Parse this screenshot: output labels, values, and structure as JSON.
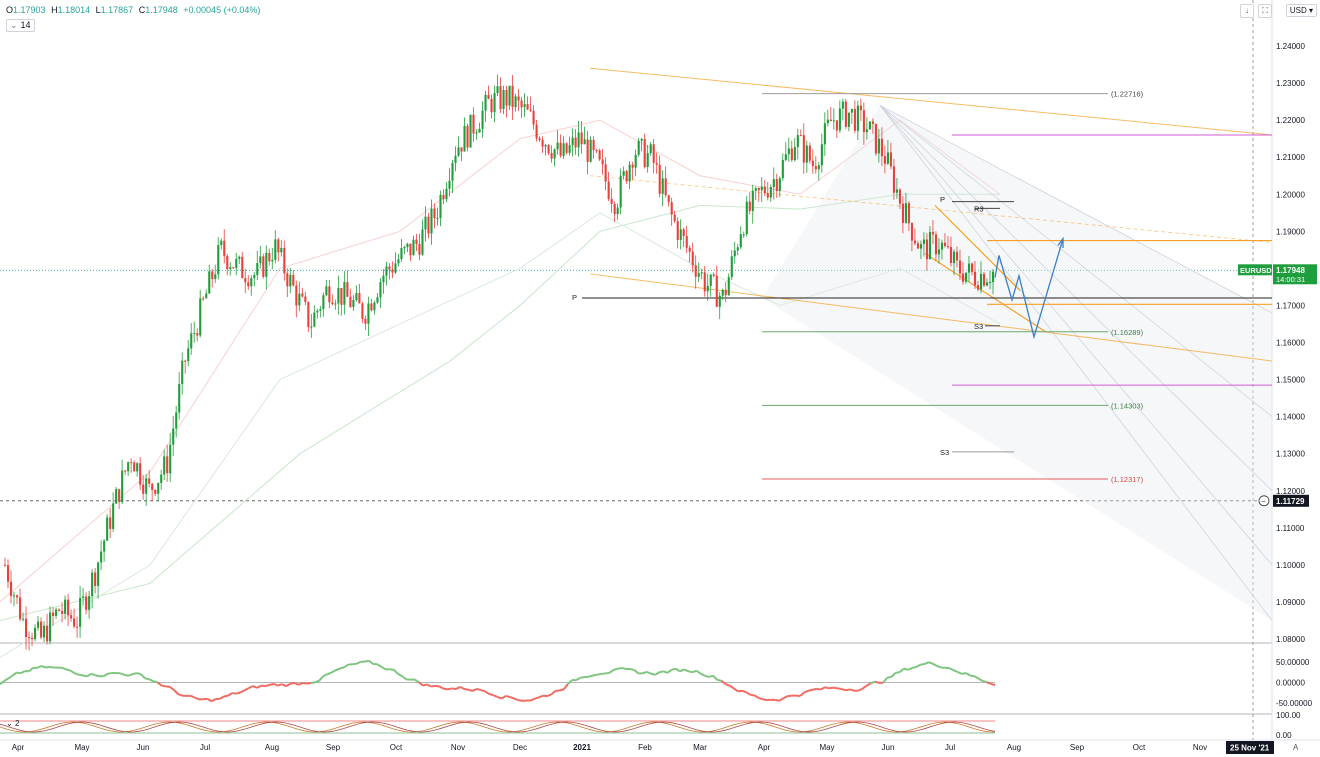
{
  "header": {
    "open_label": "O",
    "open": "1.17903",
    "high_label": "H",
    "high": "1.18014",
    "low_label": "L",
    "low": "1.17867",
    "close_label": "C",
    "close": "1.17948",
    "change": "+0.00045 (+0.04%)",
    "indicator_tag": "14",
    "indicator2_tag": "2",
    "currency": "USD"
  },
  "price_tag": {
    "symbol": "EURUSD",
    "price": "1.17948",
    "countdown": "14:00:31"
  },
  "crosshair_tag": {
    "price": "1.11729"
  },
  "date_tag": "25 Nov '21",
  "auto_label": "A",
  "levels": {
    "l1": "(1.22716)",
    "l2": "(1.16289)",
    "l3": "(1.14303)",
    "l4": "(1.12317)",
    "p_left": "P",
    "p_right": "P",
    "r3": "R3",
    "s3_upper": "S3",
    "s3_lower": "S3"
  },
  "colors": {
    "up": "#26a69a",
    "up_candle": "#1f9d3a",
    "down_candle": "#e8413b",
    "orange": "#f59f26",
    "magenta": "#d25bd6",
    "gray": "#9b9b9b",
    "red_level": "#e85c5c",
    "green_level": "#6aa870",
    "projection": "#3a7fc7",
    "osc_up": "#7dc57f",
    "osc_down": "#f06b62"
  },
  "chart_data": {
    "type": "candlestick",
    "symbol": "EURUSD",
    "y_ticks": [
      "1.24000",
      "1.23000",
      "1.22000",
      "1.21000",
      "1.20000",
      "1.19000",
      "1.18000",
      "1.17000",
      "1.16000",
      "1.15000",
      "1.14000",
      "1.13000",
      "1.12000",
      "1.11000",
      "1.10000",
      "1.09000",
      "1.08000"
    ],
    "ylim": [
      1.0795,
      1.2425
    ],
    "x_ticks": [
      "Apr",
      "May",
      "Jun",
      "Jul",
      "Aug",
      "Sep",
      "Oct",
      "Nov",
      "Dec",
      "2021",
      "Feb",
      "Mar",
      "Apr",
      "May",
      "Jun",
      "Jul",
      "Aug",
      "Sep",
      "Oct",
      "Nov"
    ],
    "approx_closes": [
      1.1,
      1.085,
      1.08,
      1.088,
      1.085,
      1.098,
      1.115,
      1.13,
      1.12,
      1.127,
      1.155,
      1.17,
      1.185,
      1.18,
      1.178,
      1.186,
      1.175,
      1.165,
      1.175,
      1.172,
      1.168,
      1.178,
      1.183,
      1.187,
      1.195,
      1.212,
      1.218,
      1.225,
      1.226,
      1.222,
      1.215,
      1.21,
      1.215,
      1.208,
      1.198,
      1.212,
      1.21,
      1.195,
      1.185,
      1.176,
      1.172,
      1.192,
      1.2,
      1.205,
      1.215,
      1.208,
      1.22,
      1.222,
      1.218,
      1.21,
      1.196,
      1.185,
      1.187,
      1.18,
      1.178,
      1.179
    ],
    "oscillator": {
      "y_ticks": [
        "50.00000",
        "0.00000",
        "-50.00000"
      ],
      "ylim": [
        -75,
        75
      ]
    },
    "stochastic": {
      "y_ticks": [
        "100.00",
        "0.00"
      ]
    }
  }
}
